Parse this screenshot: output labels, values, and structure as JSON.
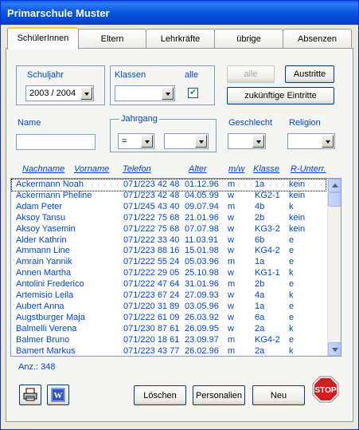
{
  "window": {
    "title": "Primarschule Muster"
  },
  "tabs": [
    "SchülerInnen",
    "Eltern",
    "Lehrkräfte",
    "übrige",
    "Absenzen"
  ],
  "filters": {
    "schuljahr_label": "Schuljahr",
    "schuljahr_value": "2003 / 2004",
    "klassen_label": "Klassen",
    "klassen_value": "",
    "alle_label": "alle",
    "alle_checked": true,
    "name_label": "Name",
    "name_value": "",
    "jahrgang_label": "Jahrgang",
    "jahrgang_op": "=",
    "jahrgang_value": "",
    "geschlecht_label": "Geschlecht",
    "geschlecht_value": "",
    "religion_label": "Religion",
    "religion_value": ""
  },
  "buttons": {
    "alle": "alle",
    "austritte": "Austritte",
    "zukuenftige": "zukünftige Eintritte",
    "loeschen": "Löschen",
    "personalien": "Personalien",
    "neu": "Neu",
    "stop": "STOP"
  },
  "columns": [
    "Nachname",
    "Vorname",
    "Telefon",
    "Alter",
    "m/w",
    "Klasse",
    "R-Unterr."
  ],
  "rows": [
    [
      "Ackermann Noah",
      "071/223 42 48",
      "01.12.96",
      "m",
      "1a",
      "kein"
    ],
    [
      "Ackermann Pheline",
      "071/223 42 48",
      "04.05.99",
      "w",
      "KG2-1",
      "kein"
    ],
    [
      "Adam Peter",
      "071/245 43 40",
      "09.07.94",
      "m",
      "4b",
      "k"
    ],
    [
      "Aksoy Tansu",
      "071/222 75 68",
      "21.01.96",
      "w",
      "2b",
      "kein"
    ],
    [
      "Aksoy Yasemin",
      "071/222 75 68",
      "07.07.98",
      "w",
      "KG3-2",
      "kein"
    ],
    [
      "Alder Kathrin",
      "071/222 33 40",
      "11.03.91",
      "w",
      "6b",
      "e"
    ],
    [
      "Ammann Line",
      "071/223 88 16",
      "15.01.98",
      "w",
      "KG4-2",
      "e"
    ],
    [
      "Amrain Yannik",
      "071/222 55 24",
      "05.03.96",
      "m",
      "1a",
      "e"
    ],
    [
      "Annen Martha",
      "071/222 29 05",
      "25.10.98",
      "w",
      "KG1-1",
      "k"
    ],
    [
      "Antolini Frederico",
      "071/222 47 64",
      "31.01.96",
      "m",
      "2b",
      "e"
    ],
    [
      "Artemisio Leila",
      "071/223 67 24",
      "27.09.93",
      "w",
      "4a",
      "k"
    ],
    [
      "Aubert Anna",
      "071/220 31 89",
      "03.05.96",
      "w",
      "1a",
      "e"
    ],
    [
      "Augstburger Maja",
      "071/222 61 09",
      "26.03.92",
      "w",
      "6a",
      "e"
    ],
    [
      "Balmelli Verena",
      "071/230 87 61",
      "26.09.95",
      "w",
      "2a",
      "k"
    ],
    [
      "Balmer Bruno",
      "071/220 18 61",
      "23.09.97",
      "m",
      "KG4-2",
      "e"
    ],
    [
      "Bamert Markus",
      "071/223 43 77",
      "26.02.96",
      "m",
      "2a",
      "k"
    ]
  ],
  "count_label": "Anz.: 348",
  "icons": {
    "print": "printer-icon",
    "word": "word-icon",
    "stop": "stop-sign-icon"
  },
  "colors": {
    "accent_blue": "#0046D5",
    "titlebar": "#0A5FE8",
    "stop_red": "#D11F1F"
  }
}
